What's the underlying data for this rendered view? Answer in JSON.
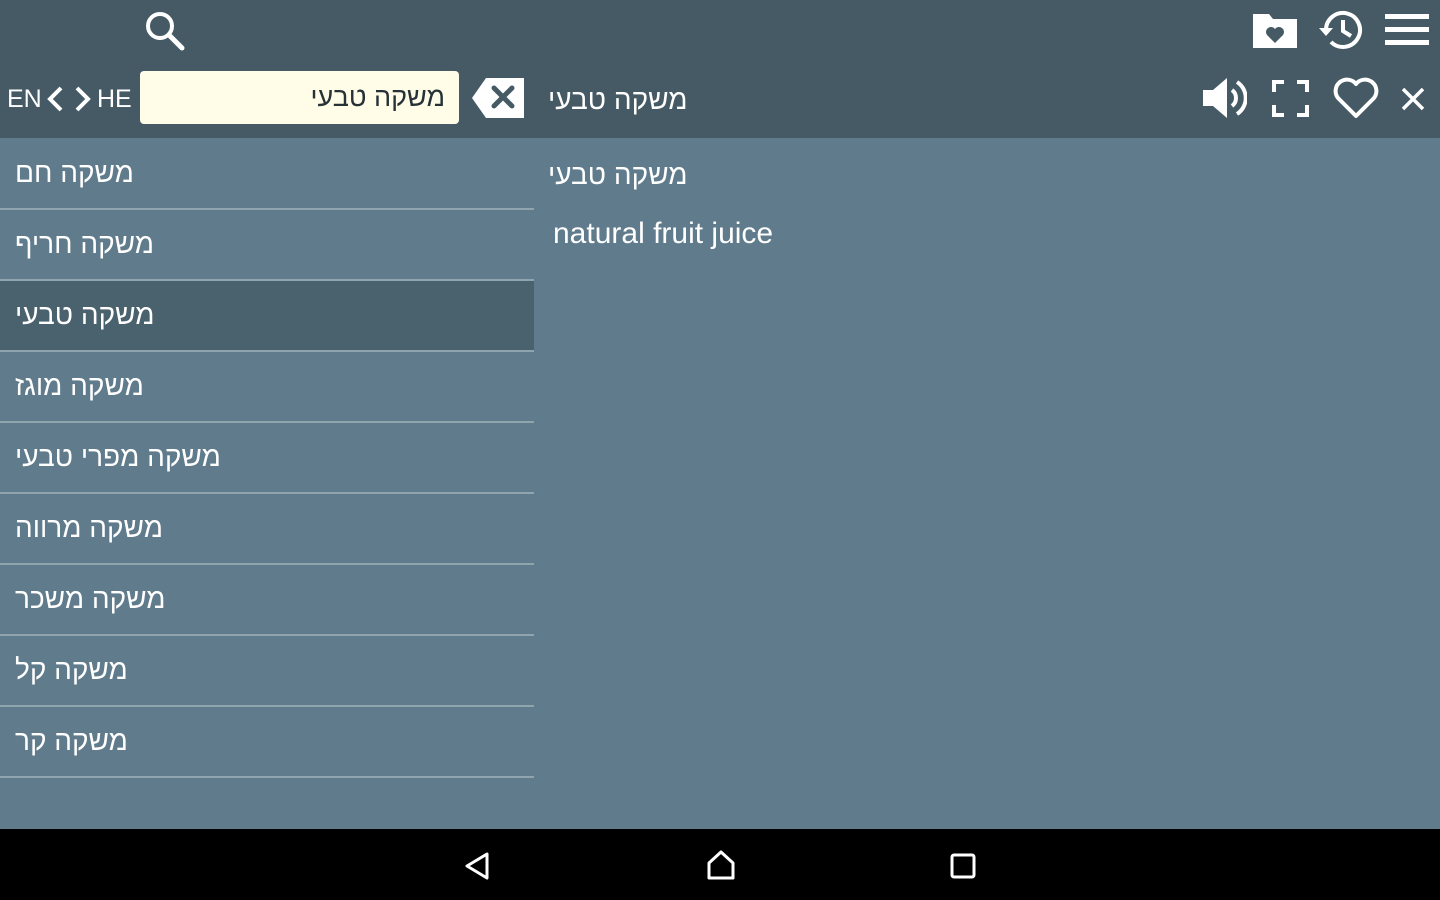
{
  "toolbar": {
    "icons": {
      "search": "search-icon",
      "favorites_folder": "folder-heart-icon",
      "history": "history-icon",
      "menu": "menu-icon"
    }
  },
  "searchbar": {
    "lang_from": "EN",
    "lang_to": "HE",
    "query": "משקה טבעי",
    "current_term": "משקה טבעי",
    "icons": {
      "swap_left": "chevron-left-icon",
      "swap_right": "chevron-right-icon",
      "clear": "backspace-clear-icon",
      "speaker": "volume-icon",
      "fullscreen": "fullscreen-icon",
      "favorite": "heart-outline-icon",
      "close": "close-icon"
    }
  },
  "word_list": {
    "items": [
      {
        "label": "משקה חם"
      },
      {
        "label": "משקה חריף"
      },
      {
        "label": "משקה טבעי",
        "selected": true
      },
      {
        "label": "משקה מוגז"
      },
      {
        "label": "משקה מפרי טבעי"
      },
      {
        "label": "משקה מרווה"
      },
      {
        "label": "משקה משכר"
      },
      {
        "label": "משקה קל"
      },
      {
        "label": "משקה קר"
      }
    ]
  },
  "detail": {
    "term": "משקה טבעי",
    "translation": "natural fruit juice"
  },
  "navbar": {
    "icons": {
      "back": "back-triangle-icon",
      "home": "home-icon",
      "recents": "recents-square-icon"
    }
  },
  "colors": {
    "toolbar": "#455a64",
    "content": "#5f7b8c",
    "selected_row": "#4a616e",
    "search_field": "#fffde7",
    "navbar": "#000000"
  }
}
